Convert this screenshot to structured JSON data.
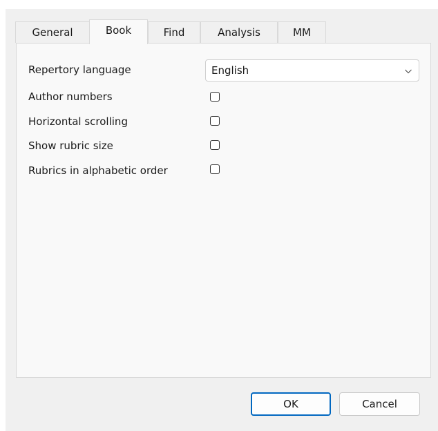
{
  "tabs": [
    {
      "label": "General",
      "active": false
    },
    {
      "label": "Book",
      "active": true
    },
    {
      "label": "Find",
      "active": false
    },
    {
      "label": "Analysis",
      "active": false
    },
    {
      "label": "MM",
      "active": false
    }
  ],
  "options": {
    "repertory_language": {
      "label": "Repertory language",
      "value": "English"
    },
    "author_numbers": {
      "label": "Author numbers",
      "checked": false
    },
    "horizontal_scrolling": {
      "label": "Horizontal scrolling",
      "checked": false
    },
    "show_rubric_size": {
      "label": "Show rubric size",
      "checked": false
    },
    "rubrics_alphabetic": {
      "label": "Rubrics in alphabetic order",
      "checked": false
    }
  },
  "buttons": {
    "ok_label": "OK",
    "cancel_label": "Cancel"
  },
  "colors": {
    "accent": "#0067c0",
    "dialog_bg": "#f0f0f0",
    "panel_bg": "#f9f9f9"
  }
}
